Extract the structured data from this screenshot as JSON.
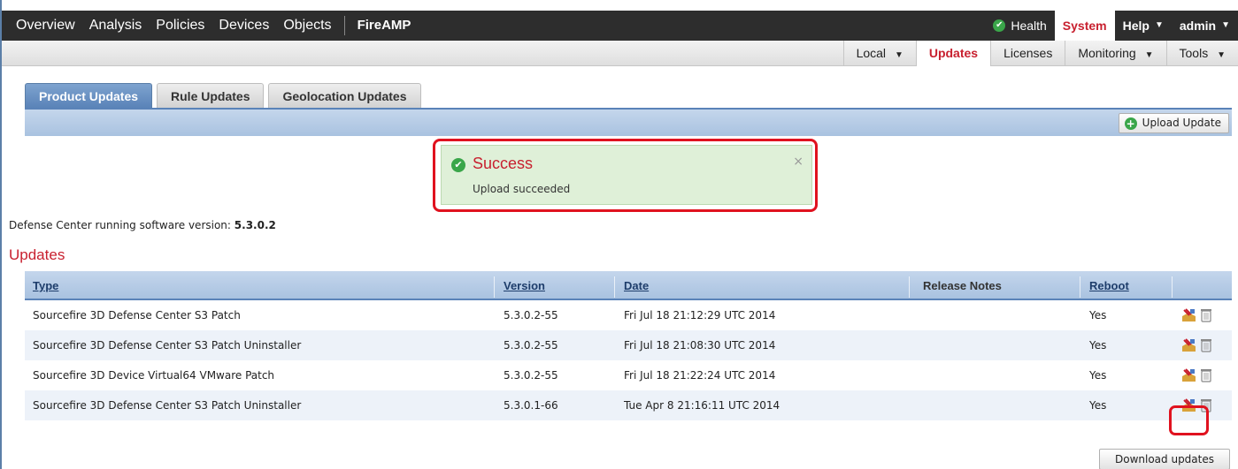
{
  "topnav": {
    "items": [
      "Overview",
      "Analysis",
      "Policies",
      "Devices",
      "Objects"
    ],
    "fireamp": "FireAMP",
    "health": "Health",
    "system": "System",
    "help": "Help",
    "admin": "admin"
  },
  "subnav": {
    "local": "Local",
    "updates": "Updates",
    "licenses": "Licenses",
    "monitoring": "Monitoring",
    "tools": "Tools"
  },
  "tabs": [
    "Product Updates",
    "Rule Updates",
    "Geolocation Updates"
  ],
  "upload_button": "Upload Update",
  "success": {
    "title": "Success",
    "message": "Upload succeeded",
    "close": "×"
  },
  "version": {
    "label": "Defense Center running software version:",
    "value": "5.3.0.2"
  },
  "updates_heading": "Updates",
  "table": {
    "headers": {
      "type": "Type",
      "version": "Version",
      "date": "Date",
      "release_notes": "Release Notes",
      "reboot": "Reboot"
    },
    "rows": [
      {
        "type": "Sourcefire 3D Defense Center S3 Patch",
        "version": "5.3.0.2-55",
        "date": "Fri Jul 18 21:12:29 UTC 2014",
        "reboot": "Yes"
      },
      {
        "type": "Sourcefire 3D Defense Center S3 Patch Uninstaller",
        "version": "5.3.0.2-55",
        "date": "Fri Jul 18 21:08:30 UTC 2014",
        "reboot": "Yes"
      },
      {
        "type": "Sourcefire 3D Device Virtual64 VMware Patch",
        "version": "5.3.0.2-55",
        "date": "Fri Jul 18 21:22:24 UTC 2014",
        "reboot": "Yes"
      },
      {
        "type": "Sourcefire 3D Defense Center S3 Patch Uninstaller",
        "version": "5.3.0.1-66",
        "date": "Tue Apr 8 21:16:11 UTC 2014",
        "reboot": "Yes"
      }
    ]
  },
  "download_button": "Download updates",
  "colors": {
    "accent_red": "#c8202f",
    "header_blue": "#5a83b8",
    "success_bg": "#dff0d8"
  },
  "icons": [
    "check-circle-icon",
    "plus-circle-icon",
    "install-icon",
    "trash-icon",
    "close-icon",
    "caret-down-icon"
  ]
}
